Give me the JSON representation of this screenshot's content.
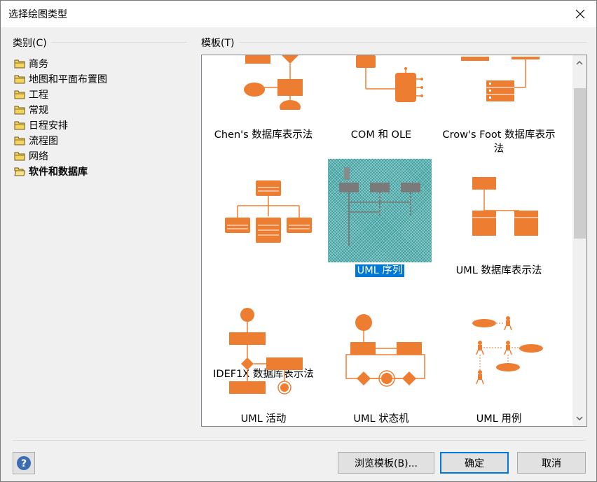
{
  "window": {
    "title": "选择绘图类型",
    "close_icon": "close-icon"
  },
  "categories": {
    "label": "类别(C)",
    "items": [
      {
        "label": "商务"
      },
      {
        "label": "地图和平面布置图"
      },
      {
        "label": "工程"
      },
      {
        "label": "常规"
      },
      {
        "label": "日程安排"
      },
      {
        "label": "流程图"
      },
      {
        "label": "网络"
      },
      {
        "label": "软件和数据库"
      }
    ],
    "selected": "软件和数据库"
  },
  "templates": {
    "label": "模板(T)",
    "items": [
      {
        "label": "Chen's 数据库表示法"
      },
      {
        "label": "COM 和 OLE"
      },
      {
        "label": "Crow's Foot 数据库表示法"
      },
      {
        "label": "IDEF1X 数据库表示法"
      },
      {
        "label": "UML 序列"
      },
      {
        "label": "UML 数据库表示法"
      },
      {
        "label": "UML 活动"
      },
      {
        "label": "UML 状态机"
      },
      {
        "label": "UML 用例"
      }
    ],
    "selected": "UML 序列"
  },
  "buttons": {
    "browse": "浏览模板(B)...",
    "ok": "确定",
    "cancel": "取消"
  },
  "colors": {
    "accent": "#ed7d31",
    "selection": "#0078d7"
  }
}
